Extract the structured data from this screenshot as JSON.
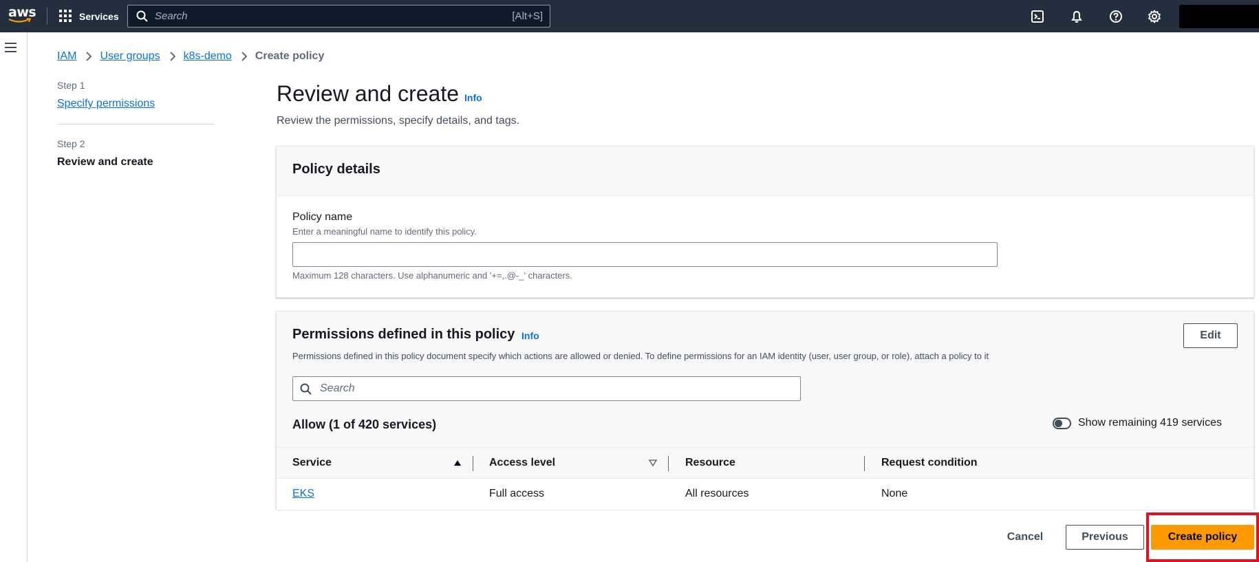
{
  "topnav": {
    "logo_text": "aws",
    "services_label": "Services",
    "search_placeholder": "Search",
    "search_shortcut": "[Alt+S]",
    "icons": [
      "cloudshell-icon",
      "bell-icon",
      "help-icon",
      "gear-icon"
    ]
  },
  "breadcrumb": {
    "items": [
      "IAM",
      "User groups",
      "k8s-demo"
    ],
    "current": "Create policy"
  },
  "steps": {
    "step1_label": "Step 1",
    "step1_link": "Specify permissions",
    "step2_label": "Step 2",
    "step2_current": "Review and create"
  },
  "header": {
    "title": "Review and create",
    "info": "Info",
    "description": "Review the permissions, specify details, and tags."
  },
  "policy_details": {
    "title": "Policy details",
    "field_label": "Policy name",
    "field_description": "Enter a meaningful name to identify this policy.",
    "field_value": "",
    "constraint": "Maximum 128 characters. Use alphanumeric and '+=,.@-_' characters."
  },
  "permissions": {
    "title": "Permissions defined in this policy",
    "info": "Info",
    "edit_label": "Edit",
    "description": "Permissions defined in this policy document specify which actions are allowed or denied. To define permissions for an IAM identity (user, user group, or role), attach a policy to it",
    "search_placeholder": "Search",
    "allow_title": "Allow (1 of 420 services)",
    "toggle_label": "Show remaining 419 services",
    "toggle_on": false,
    "columns": [
      "Service",
      "Access level",
      "Resource",
      "Request condition"
    ],
    "rows": [
      {
        "service": "EKS",
        "access_level": "Full access",
        "resource": "All resources",
        "request_condition": "None"
      }
    ]
  },
  "actions": {
    "cancel": "Cancel",
    "previous": "Previous",
    "create": "Create policy"
  },
  "colors": {
    "nav_bg": "#232f3e",
    "link": "#0972d3",
    "primary_button": "#ff9900",
    "highlight": "#e3101f"
  }
}
